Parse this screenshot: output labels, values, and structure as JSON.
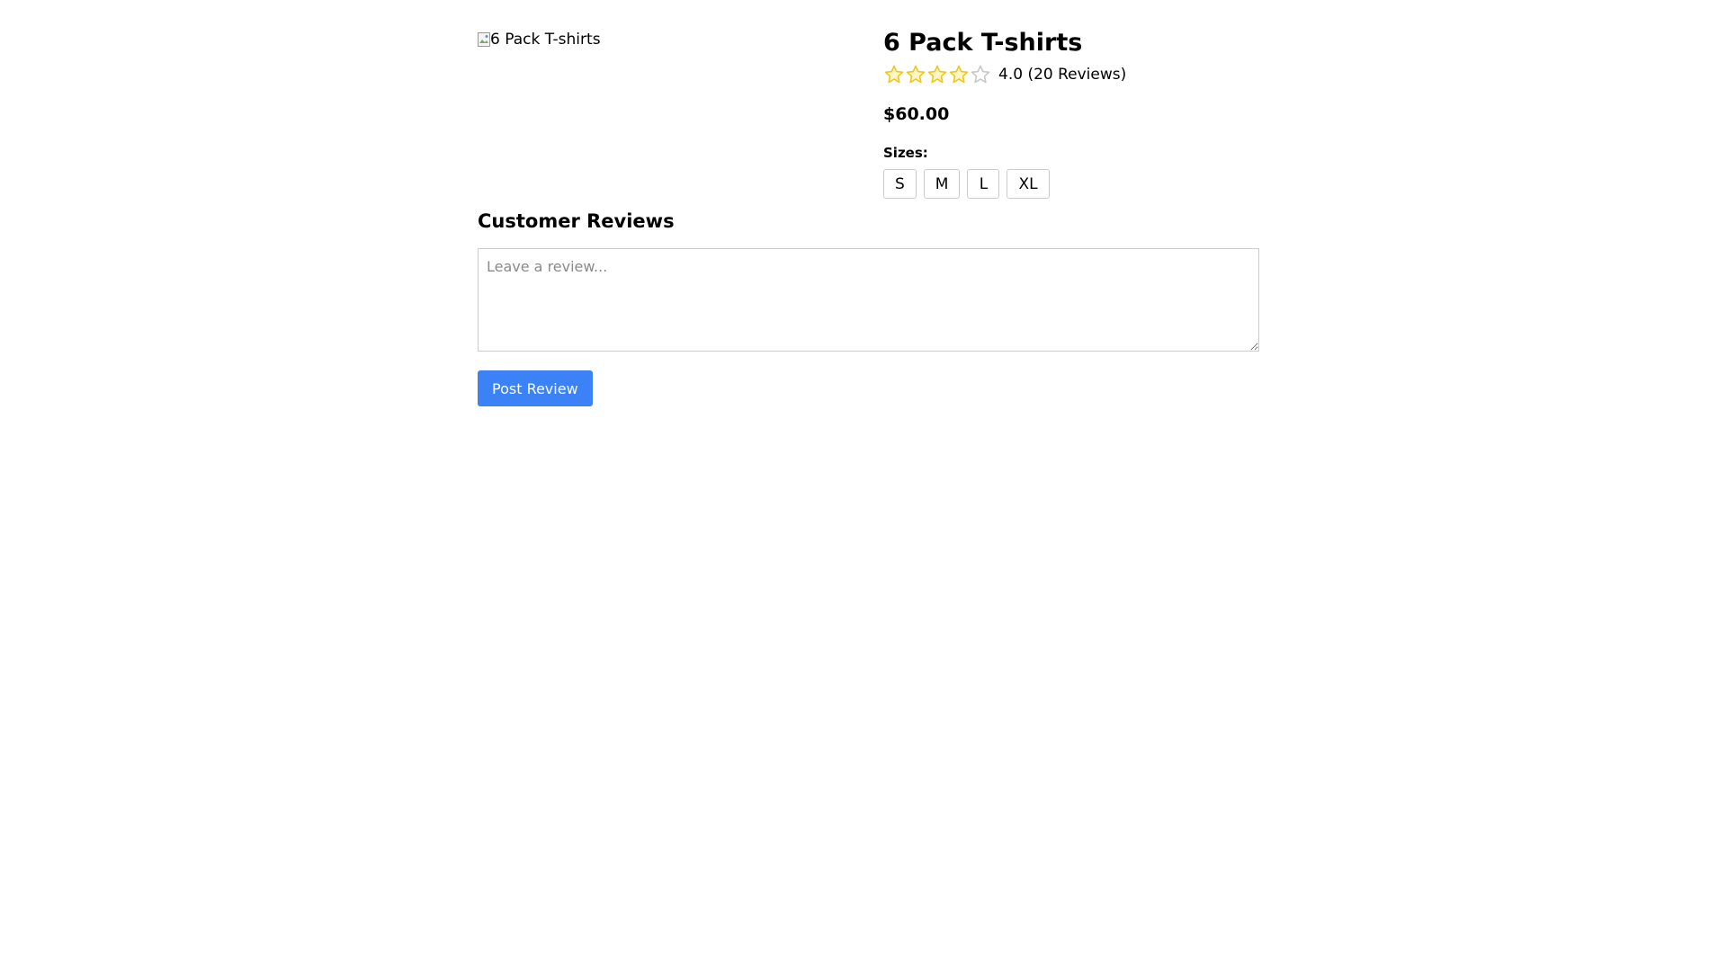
{
  "product": {
    "image_alt": "6 Pack T-shirts",
    "title": "6 Pack T-shirts",
    "rating": 4.0,
    "rating_max": 5,
    "rating_text": "4.0 (20 Reviews)",
    "price": "$60.00",
    "sizes_label": "Sizes:",
    "sizes": [
      "S",
      "M",
      "L",
      "XL"
    ],
    "star_filled_color": "#f5c518",
    "star_empty_color": "#c8c8c8"
  },
  "reviews": {
    "title": "Customer Reviews",
    "placeholder": "Leave a review...",
    "post_label": "Post Review",
    "button_color": "#3b82f6"
  },
  "icons": {
    "broken_image": "broken-image-icon",
    "star": "star-icon"
  }
}
